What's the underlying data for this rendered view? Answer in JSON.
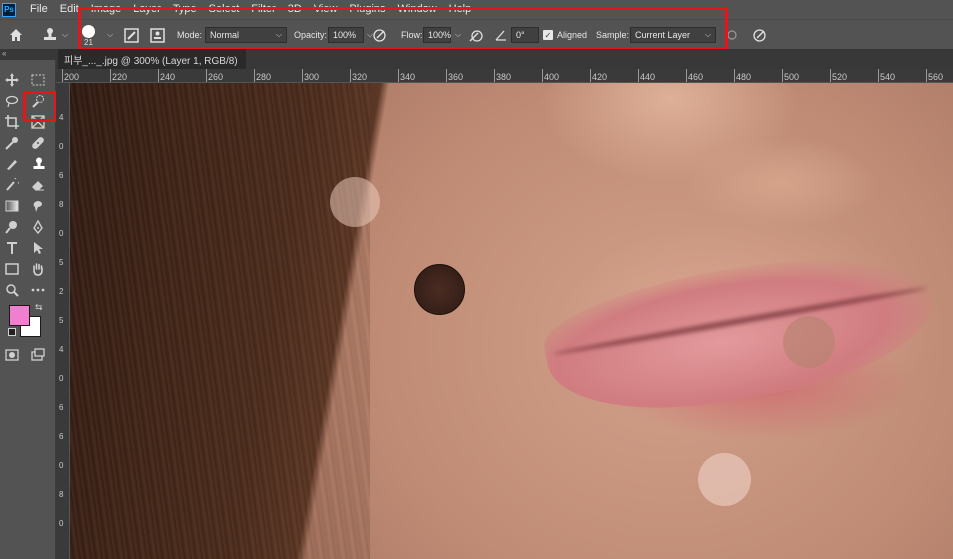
{
  "app": {
    "logo_text": "Ps"
  },
  "menu": [
    "File",
    "Edit",
    "Image",
    "Layer",
    "Type",
    "Select",
    "Filter",
    "3D",
    "View",
    "Plugins",
    "Window",
    "Help"
  ],
  "options_bar": {
    "brush_size": "21",
    "mode_label": "Mode:",
    "mode_value": "Normal",
    "opacity_label": "Opacity:",
    "opacity_value": "100%",
    "flow_label": "Flow:",
    "flow_value": "100%",
    "angle_value": "0°",
    "aligned_label": "Aligned",
    "aligned_checked": true,
    "sample_label": "Sample:",
    "sample_value": "Current Layer"
  },
  "document_tab": {
    "title": "피부_..._.jpg @ 300% (Layer 1, RGB/8)",
    "close": "×"
  },
  "ruler_top": [
    "200",
    "220",
    "240",
    "260",
    "280",
    "300",
    "320",
    "340",
    "360",
    "380",
    "400",
    "420",
    "440",
    "460",
    "480",
    "500",
    "520",
    "540",
    "560"
  ],
  "ruler_left": [
    "4",
    "0",
    "6",
    "8",
    "0",
    "5",
    "2",
    "5",
    "4",
    "0",
    "6",
    "6",
    "0",
    "8",
    "0"
  ],
  "toolbar": {
    "foreground_color": "#f07fd0",
    "background_color": "#ffffff"
  },
  "accent": {
    "highlight": "#e8141b"
  }
}
